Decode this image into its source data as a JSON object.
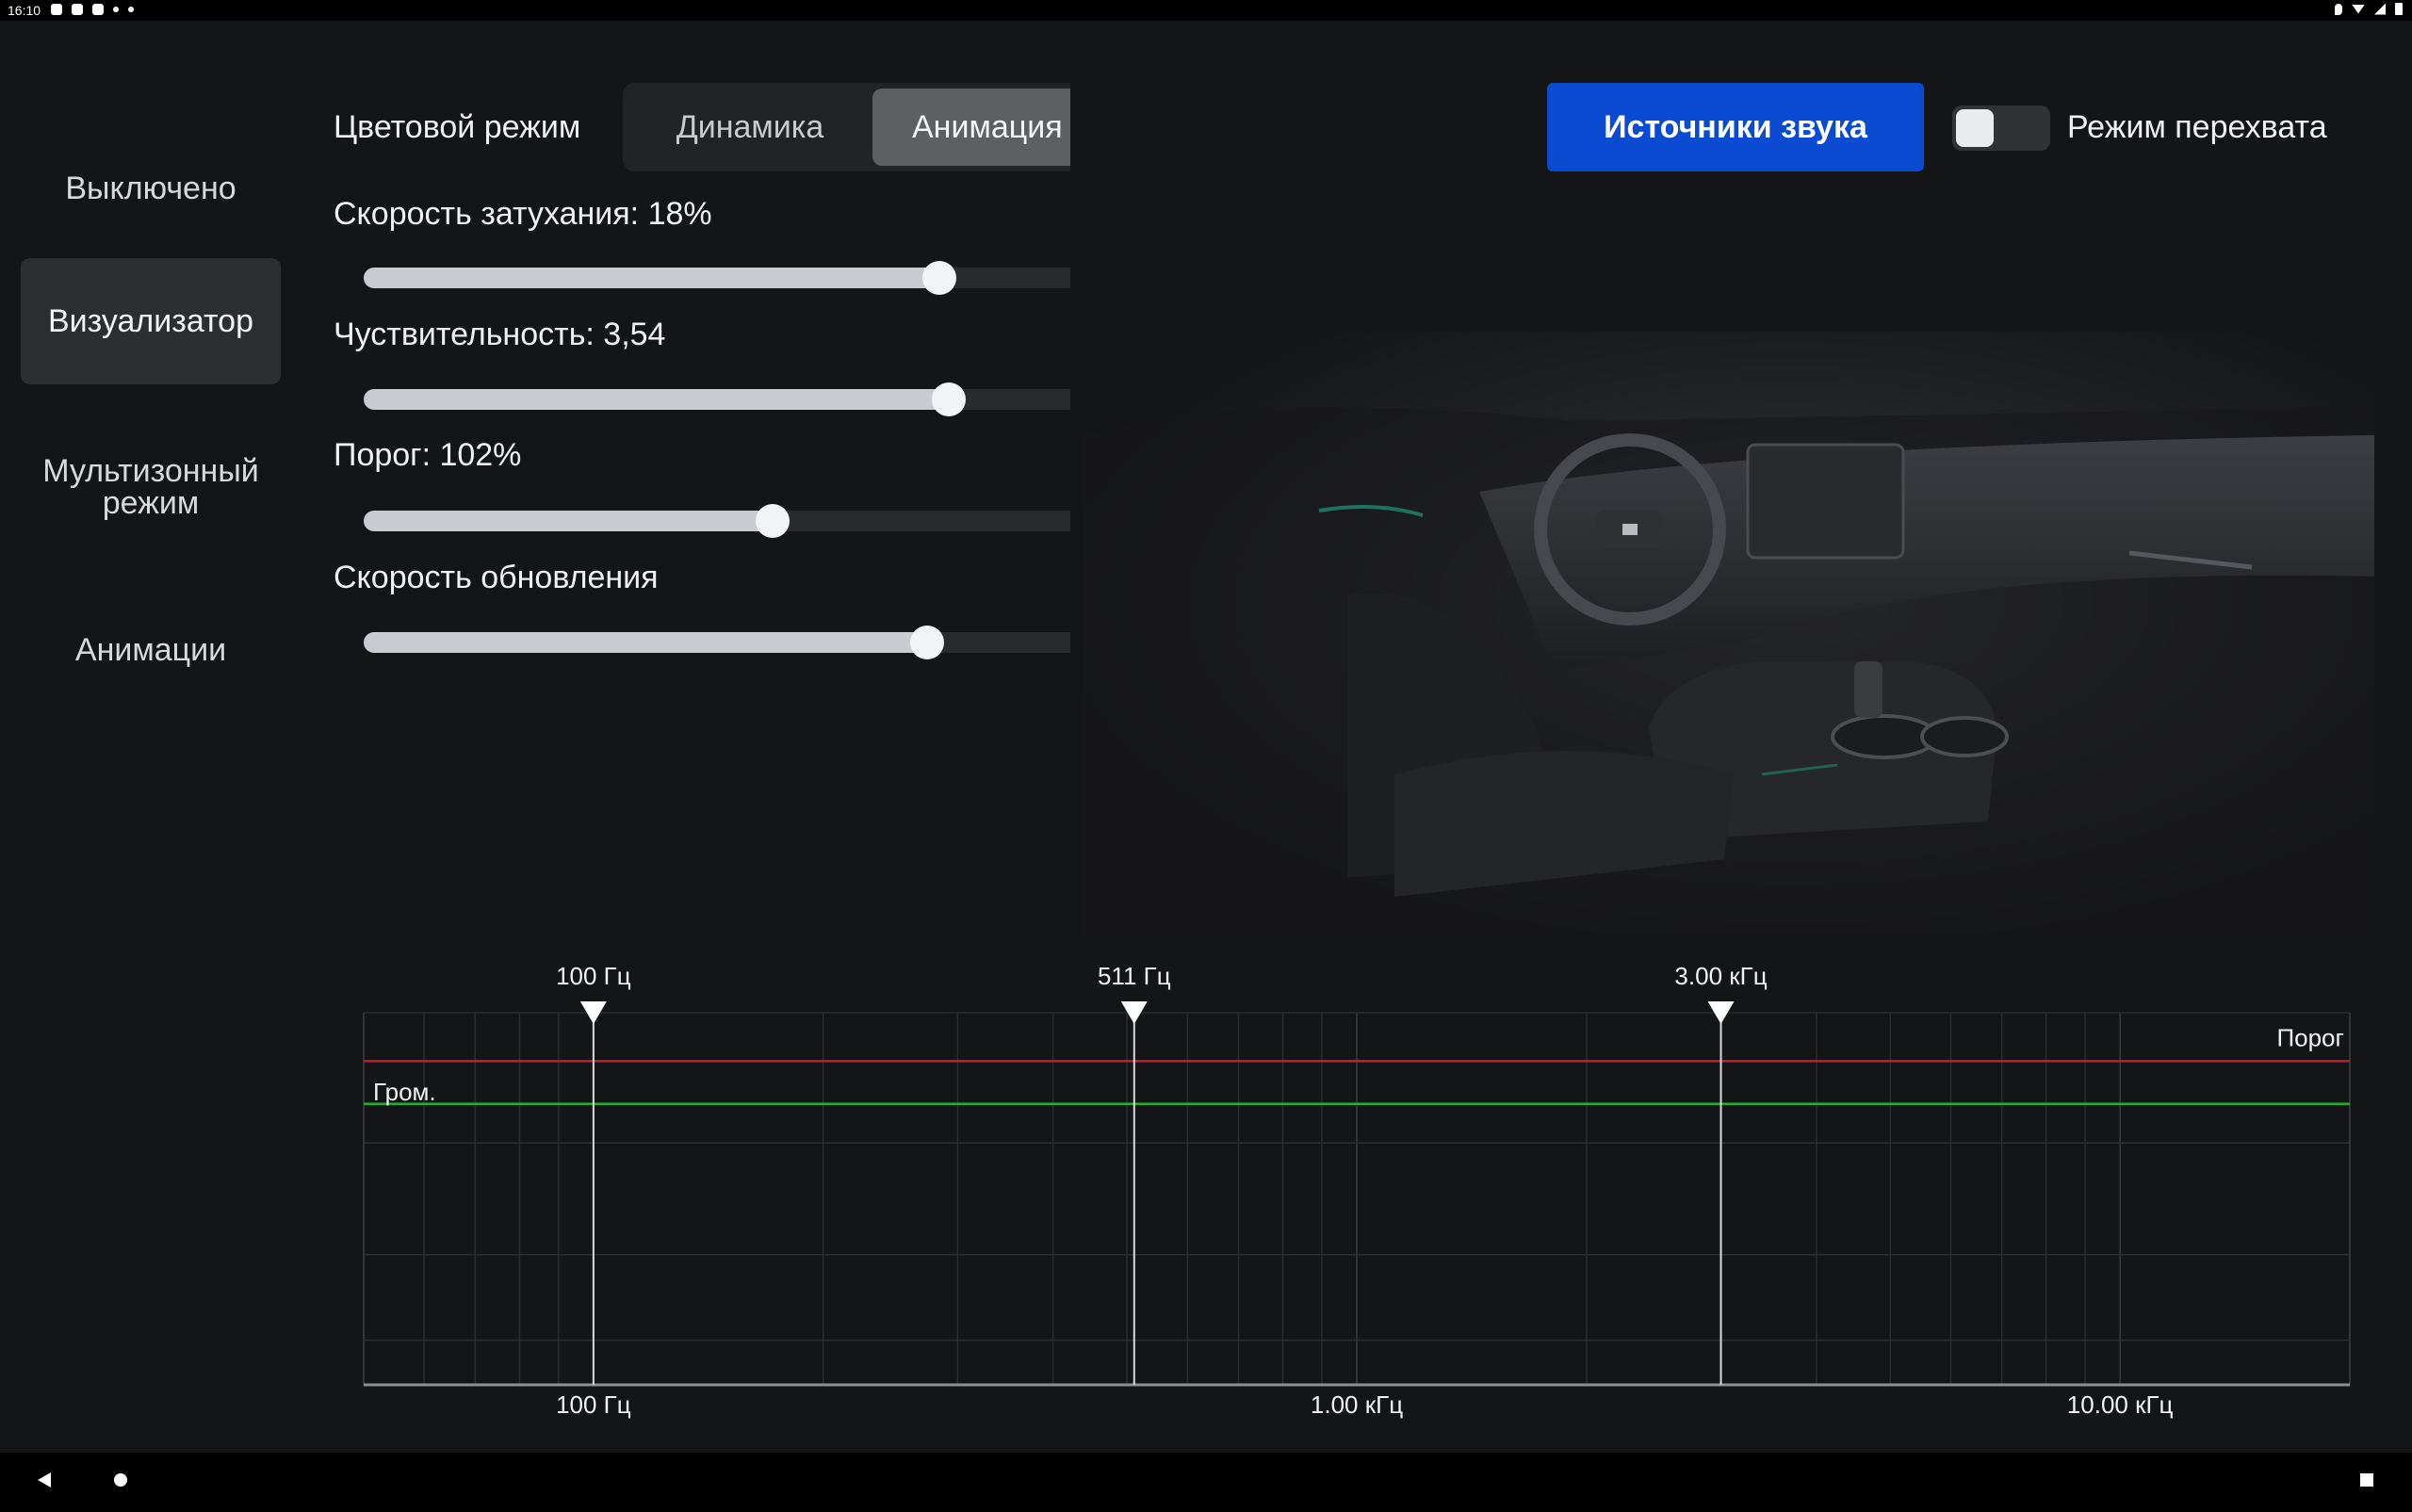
{
  "status_bar": {
    "time": "16:10",
    "left_icons": [
      "app-icon",
      "app-icon",
      "app-icon",
      "notification-icon",
      "dot-icon"
    ],
    "right_icons": [
      "location-icon",
      "wifi-icon",
      "signal-icon",
      "battery-icon"
    ]
  },
  "sidebar": {
    "items": [
      {
        "label": "Выключено",
        "active": false
      },
      {
        "label": "Визуализатор",
        "active": true
      },
      {
        "label": "Мультизонный режим",
        "active": false
      },
      {
        "label": "Анимации",
        "active": false
      }
    ]
  },
  "color_mode": {
    "label": "Цветовой режим",
    "options": [
      "Динамика",
      "Анимация"
    ],
    "selected": "Анимация"
  },
  "sliders": [
    {
      "label": "Скорость затухания: 18%",
      "fraction": 0.815
    },
    {
      "label": "Чуствительность: 3,54",
      "fraction": 0.828
    },
    {
      "label": "Порог: 102%",
      "fraction": 0.578
    },
    {
      "label": "Скорость обновления",
      "fraction": 0.797
    }
  ],
  "header": {
    "sources_button": "Источники звука",
    "intercept_label": "Режим перехвата",
    "intercept_on": false,
    "accent_color": "#0a4bd1"
  },
  "chart_data": {
    "type": "line",
    "x_scale": "log",
    "x_unit": "Гц",
    "x_range": [
      50,
      20000
    ],
    "x_ticks": [
      {
        "value": 100,
        "label": "100 Гц"
      },
      {
        "value": 1000,
        "label": "1.00 кГц"
      },
      {
        "value": 10000,
        "label": "10.00 кГц"
      }
    ],
    "markers": [
      {
        "value": 100,
        "label": "100 Гц"
      },
      {
        "value": 511,
        "label": "511 Гц"
      },
      {
        "value": 3000,
        "label": "3.00 кГц"
      }
    ],
    "series": [
      {
        "name": "Порог",
        "level": 0.87,
        "color": "#c0202a"
      },
      {
        "name": "Гром.",
        "level": 0.755,
        "color": "#22b02a"
      }
    ],
    "y_range": [
      0,
      1
    ],
    "grid": true
  }
}
